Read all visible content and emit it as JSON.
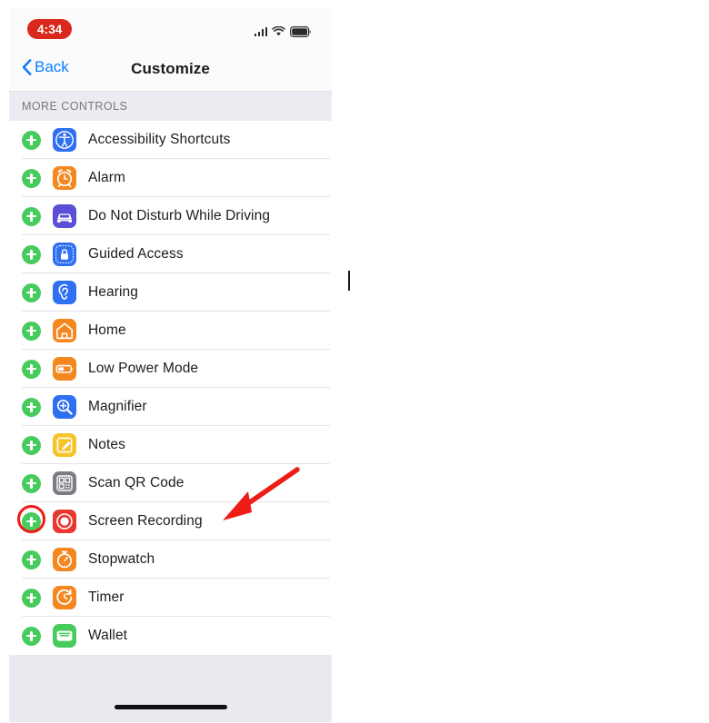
{
  "screenshot": {
    "title": "iOS Settings - Control Center Customize",
    "device_frame_width": 355
  },
  "status_bar": {
    "time": "4:34",
    "recording_indicator": true,
    "recording_pill_color": "#d9291c",
    "icons": [
      "cellular-signal-icon",
      "wifi-icon",
      "battery-icon"
    ],
    "cellular_bars": 4,
    "battery_level_label": ""
  },
  "nav_bar": {
    "back_label": "Back",
    "back_tint": "#0a7cff",
    "title": "Customize"
  },
  "section": {
    "header": "MORE CONTROLS"
  },
  "theme": {
    "add_button_color": "#46cb5c",
    "annotation_color": "#ee1b16",
    "separator_color": "#e4e4e9",
    "section_bg": "#ebebf1"
  },
  "controls": [
    {
      "label": "Accessibility Shortcuts",
      "icon_name": "accessibility-icon",
      "icon_bg": "#2f6ff2",
      "add_action": "add",
      "highlighted": false
    },
    {
      "label": "Alarm",
      "icon_name": "alarm-clock-icon",
      "icon_bg": "#f5871f",
      "add_action": "add",
      "highlighted": false
    },
    {
      "label": "Do Not Disturb While Driving",
      "icon_name": "car-icon",
      "icon_bg": "#5a4fd6",
      "add_action": "add",
      "highlighted": false
    },
    {
      "label": "Guided Access",
      "icon_name": "lock-icon",
      "icon_bg": "#2f6ff2",
      "add_action": "add",
      "highlighted": false
    },
    {
      "label": "Hearing",
      "icon_name": "ear-icon",
      "icon_bg": "#2f6ff2",
      "add_action": "add",
      "highlighted": false
    },
    {
      "label": "Home",
      "icon_name": "house-icon",
      "icon_bg": "#f5871f",
      "add_action": "add",
      "highlighted": false
    },
    {
      "label": "Low Power Mode",
      "icon_name": "battery-icon",
      "icon_bg": "#f5871f",
      "add_action": "add",
      "highlighted": false
    },
    {
      "label": "Magnifier",
      "icon_name": "magnifier-icon",
      "icon_bg": "#2f6ff2",
      "add_action": "add",
      "highlighted": false
    },
    {
      "label": "Notes",
      "icon_name": "notes-pencil-icon",
      "icon_bg": "#f6c32a",
      "add_action": "add",
      "highlighted": false
    },
    {
      "label": "Scan QR Code",
      "icon_name": "qr-code-icon",
      "icon_bg": "#7c7c82",
      "add_action": "add",
      "highlighted": false
    },
    {
      "label": "Screen Recording",
      "icon_name": "record-circle-icon",
      "icon_bg": "#e8382f",
      "add_action": "add",
      "highlighted": true
    },
    {
      "label": "Stopwatch",
      "icon_name": "stopwatch-icon",
      "icon_bg": "#f5871f",
      "add_action": "add",
      "highlighted": false
    },
    {
      "label": "Timer",
      "icon_name": "timer-icon",
      "icon_bg": "#f5871f",
      "add_action": "add",
      "highlighted": false
    },
    {
      "label": "Wallet",
      "icon_name": "wallet-icon",
      "icon_bg": "#46cb5c",
      "add_action": "add",
      "highlighted": false
    }
  ],
  "annotations": {
    "arrow": {
      "name": "red-arrow-pointer",
      "color": "#ee1b16",
      "points_to": "Screen Recording"
    },
    "ring": {
      "name": "red-highlight-ring",
      "color": "#ee1b16",
      "around": "Screen Recording add button"
    },
    "text_cursor_visible": true
  },
  "footer": {
    "home_indicator": true
  }
}
